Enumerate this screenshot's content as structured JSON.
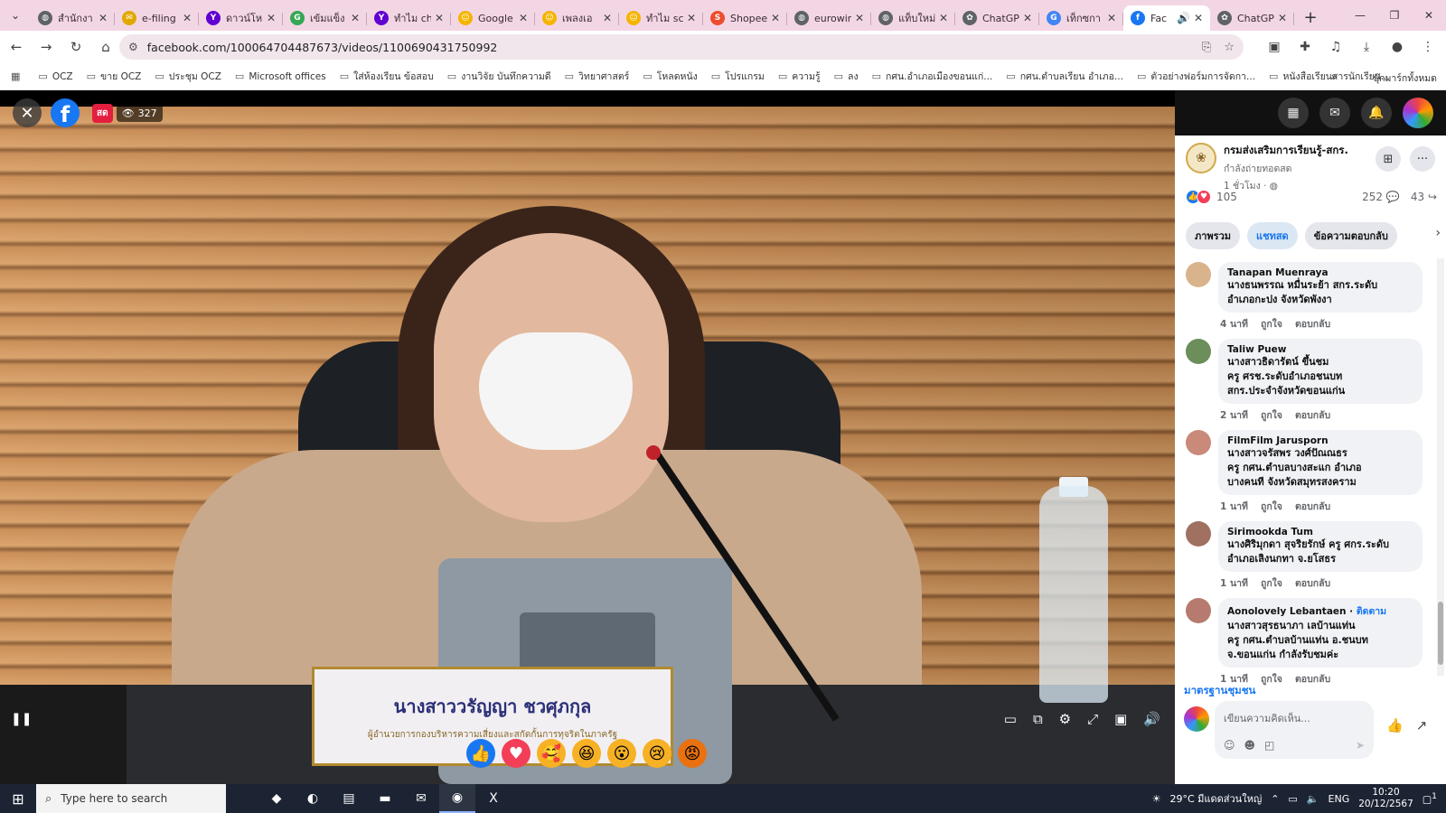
{
  "browser": {
    "tabs": [
      {
        "label": "สำนักงา",
        "color": "#5f6368",
        "glyph": "◍"
      },
      {
        "label": "e-filing",
        "color": "#e0a800",
        "glyph": "✉"
      },
      {
        "label": "ดาวน์โห",
        "color": "#6001d2",
        "glyph": "Y"
      },
      {
        "label": "เข้มแข็ง",
        "color": "#34a853",
        "glyph": "G"
      },
      {
        "label": "ทำไม ch",
        "color": "#6001d2",
        "glyph": "Y"
      },
      {
        "label": "Google",
        "color": "#f4b400",
        "glyph": "☺"
      },
      {
        "label": "เพลงเอ",
        "color": "#f4b400",
        "glyph": "☺"
      },
      {
        "label": "ทำไม sc",
        "color": "#f4b400",
        "glyph": "☺"
      },
      {
        "label": "Shopee",
        "color": "#ee4d2d",
        "glyph": "S"
      },
      {
        "label": "eurowin",
        "color": "#5f6368",
        "glyph": "◍"
      },
      {
        "label": "แท็บใหม่",
        "color": "#5f6368",
        "glyph": "◍"
      },
      {
        "label": "ChatGP",
        "color": "#5f6368",
        "glyph": "✿"
      },
      {
        "label": "เท็กซกา",
        "color": "#4285f4",
        "glyph": "G"
      },
      {
        "label": "Fac",
        "color": "#1877f2",
        "glyph": "f",
        "active": true
      },
      {
        "label": "ChatGP",
        "color": "#5f6368",
        "glyph": "✿"
      }
    ],
    "url": "facebook.com/100064704487673/videos/1100690431750992",
    "bookmarks": [
      "OCZ",
      "ขาย OCZ",
      "ประชุม OCZ",
      "Microsoft offices",
      "ใส่ห้องเรียน ข้อสอบ",
      "งานวิจัย บันทึกความดี",
      "วิทยาศาสตร์",
      "โหลดหนัง",
      "โปรแกรม",
      "ความรู้",
      "ลง",
      "กศน.อำเภอเมืองขอนแก่...",
      "กศน.ตำบลเรียน อำเภอ...",
      "ตัวอย่างฟอร์มการจัดกา...",
      "หนังสือเรียนสารนักเรียน..."
    ],
    "bookmarks_right": "บุ๊กมาร์กทั้งหมด"
  },
  "video": {
    "live_label": "สด",
    "viewer_count": "327",
    "nameplate_name": "นางสาววรัญญา ชวศุภกุล",
    "nameplate_title": "ผู้อำนวยการกองบริหารความเสี่ยงและสกัดกั้นการทุจริตในภาครัฐ"
  },
  "panel": {
    "page_name": "กรมส่งเสริมการเรียนรู้-สกร.",
    "page_status": "กำลังถ่ายทอดสด",
    "page_time": "1 ชั่วโมง · ◍",
    "reaction_count": "105",
    "comment_count": "252",
    "share_count": "43",
    "tabs": [
      "ภาพรวม",
      "แชทสด",
      "ข้อความตอบกลับ"
    ],
    "comments": [
      {
        "name": "Tanapan Muenraya",
        "follow": "",
        "text": [
          "นางธนพรรณ หมื่นระย้า สกร.ระดับ",
          "อำเภอกะปง จังหวัดพังงา"
        ],
        "time": "4 นาที",
        "avatar": "#d9b38c"
      },
      {
        "name": "Taliw Puew",
        "follow": "",
        "text": [
          "นางสาวธิดารัตน์ ขึ้นชม",
          "ครู ศรช.ระดับอำเภอชนบท",
          "สกร.ประจำจังหวัดขอนแก่น"
        ],
        "time": "2 นาที",
        "avatar": "#6b8e5a"
      },
      {
        "name": "FilmFilm Jarusporn",
        "follow": "",
        "text": [
          "นางสาวจรัสพร วงศ์ปัณณธร",
          "ครู กศน.ตำบลบางสะแก อำเภอ",
          "บางคนที จังหวัดสมุทรสงคราม"
        ],
        "time": "1 นาที",
        "avatar": "#c98a7a"
      },
      {
        "name": "Sirimookda Tum",
        "follow": "",
        "text": [
          "นางศิริมุกดา สุจริยรักษ์ ครู ศกร.ระดับ",
          "อำเภอเลิงนกทา จ.ยโสธร"
        ],
        "time": "1 นาที",
        "avatar": "#a07060"
      },
      {
        "name": "Aonolovely Lebantaen",
        "follow": "ติดตาม",
        "text": [
          "นางสาวสุรธนาภา เลบ้านแท่น",
          "ครู กศน.ตำบลบ้านแท่น อ.ชนบท",
          "จ.ขอนแก่น กำลังรับชมค่ะ"
        ],
        "time": "1 นาที",
        "avatar": "#b77a6e"
      }
    ],
    "like_label": "ถูกใจ",
    "reply_label": "ตอบกลับ",
    "moderation_link": "มาตรฐานชุมชน",
    "composer_placeholder": "เขียนความคิดเห็น..."
  },
  "taskbar": {
    "search_placeholder": "Type here to search",
    "weather": "29°C มีแดดส่วนใหญ่",
    "lang": "ENG",
    "time": "10:20",
    "date": "20/12/2567",
    "notif_count": "1"
  }
}
